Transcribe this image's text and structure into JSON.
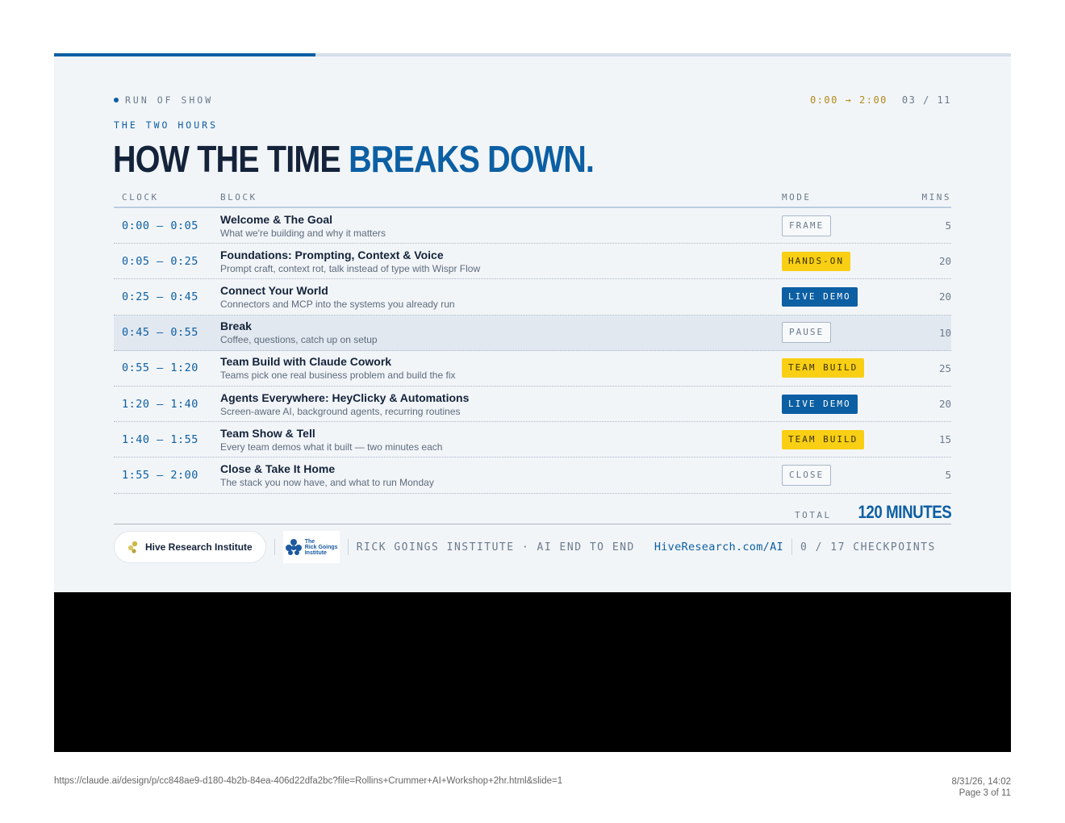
{
  "progress": {
    "fraction": 0.273
  },
  "header": {
    "eyebrow": "RUN OF SHOW",
    "time_range": "0:00 → 2:00",
    "page_counter": "03 / 11",
    "subhead": "THE TWO HOURS",
    "headline_dark": "HOW THE TIME",
    "headline_accent": "BREAKS DOWN."
  },
  "table": {
    "columns": {
      "clock": "CLOCK",
      "block": "BLOCK",
      "mode": "MODE",
      "mins": "MINS"
    },
    "rows": [
      {
        "clock": "0:00 — 0:05",
        "title": "Welcome & The Goal",
        "desc": "What we're building and why it matters",
        "mode": "FRAME",
        "style": "outline",
        "mins": "5"
      },
      {
        "clock": "0:05 — 0:25",
        "title": "Foundations: Prompting, Context & Voice",
        "desc": "Prompt craft, context rot, talk instead of type with Wispr Flow",
        "mode": "HANDS-ON",
        "style": "yellow",
        "mins": "20"
      },
      {
        "clock": "0:25 — 0:45",
        "title": "Connect Your World",
        "desc": "Connectors and MCP into the systems you already run",
        "mode": "LIVE DEMO",
        "style": "blue",
        "mins": "20"
      },
      {
        "clock": "0:45 — 0:55",
        "title": "Break",
        "desc": "Coffee, questions, catch up on setup",
        "mode": "PAUSE",
        "style": "outline",
        "mins": "10",
        "highlight": true
      },
      {
        "clock": "0:55 — 1:20",
        "title": "Team Build with Claude Cowork",
        "desc": "Teams pick one real business problem and build the fix",
        "mode": "TEAM BUILD",
        "style": "yellow",
        "mins": "25"
      },
      {
        "clock": "1:20 — 1:40",
        "title": "Agents Everywhere: HeyClicky & Automations",
        "desc": "Screen-aware AI, background agents, recurring routines",
        "mode": "LIVE DEMO",
        "style": "blue",
        "mins": "20"
      },
      {
        "clock": "1:40 — 1:55",
        "title": "Team Show & Tell",
        "desc": "Every team demos what it built — two minutes each",
        "mode": "TEAM BUILD",
        "style": "yellow",
        "mins": "15"
      },
      {
        "clock": "1:55 — 2:00",
        "title": "Close & Take It Home",
        "desc": "The stack you now have, and what to run Monday",
        "mode": "CLOSE",
        "style": "outline",
        "mins": "5"
      }
    ],
    "total_label": "TOTAL",
    "total_value": "120 MINUTES"
  },
  "footer": {
    "hive_logo_text": "Hive Research Institute",
    "rg_logo_lines": [
      "The",
      "Rick Goings",
      "Institute"
    ],
    "institute": "RICK GOINGS INSTITUTE · AI END TO END",
    "url": "HiveResearch.com/AI",
    "checkpoints": "0 / 17 CHECKPOINTS"
  },
  "print": {
    "url": "https://claude.ai/design/p/cc848ae9-d180-4b2b-84ea-406d22dfa2bc?file=Rollins+Crummer+AI+Workshop+2hr.html&slide=1",
    "datetime": "8/31/26, 14:02",
    "page": "Page 3 of 11"
  },
  "colors": {
    "accent": "#0c5fa3",
    "yellow": "#f8cf14",
    "ink": "#14233a",
    "panel": "#f2f5f8"
  }
}
